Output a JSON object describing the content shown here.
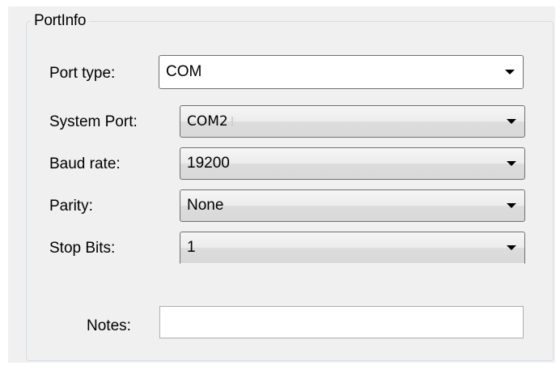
{
  "group": {
    "title": "PortInfo"
  },
  "fields": {
    "port_type": {
      "label": "Port type:",
      "value": "COM"
    },
    "system_port": {
      "label": "System Port:",
      "value": "COM2"
    },
    "baud_rate": {
      "label": "Baud rate:",
      "value": "19200"
    },
    "parity": {
      "label": "Parity:",
      "value": "None"
    },
    "stop_bits": {
      "label": "Stop Bits:",
      "value": "1"
    },
    "notes": {
      "label": "Notes:",
      "value": ""
    }
  },
  "icons": {
    "dropdown": "chevron-down-icon"
  }
}
